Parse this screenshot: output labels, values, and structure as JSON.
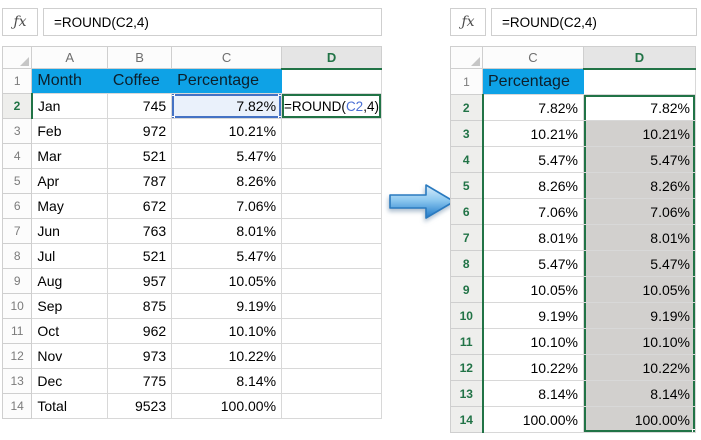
{
  "colors": {
    "header_fill_blue": "#0ea2e6",
    "excel_green": "#217346",
    "selection_gray": "#d2d0ce",
    "reference_blue": "#4a6fd4",
    "reference_fill": "#eaf1fb",
    "arrow_blue": "#1e78c8"
  },
  "left_sheet": {
    "formula_bar": {
      "fx_label": "ƒx",
      "formula": "=ROUND(C2,4)"
    },
    "column_headers": [
      "A",
      "B",
      "C",
      "D"
    ],
    "selected_column": "D",
    "row1_number": "1",
    "table_headers": {
      "a": "Month",
      "b": "Coffee",
      "c": "Percentage"
    },
    "active_row": {
      "n": "2",
      "a": "Jan",
      "b": "745",
      "c": "7.82%",
      "formula_pre": "=ROUND(",
      "formula_ref": "C2",
      "formula_post": ",4)"
    },
    "rows": [
      {
        "n": "3",
        "a": "Feb",
        "b": "972",
        "c": "10.21%"
      },
      {
        "n": "4",
        "a": "Mar",
        "b": "521",
        "c": "5.47%"
      },
      {
        "n": "5",
        "a": "Apr",
        "b": "787",
        "c": "8.26%"
      },
      {
        "n": "6",
        "a": "May",
        "b": "672",
        "c": "7.06%"
      },
      {
        "n": "7",
        "a": "Jun",
        "b": "763",
        "c": "8.01%"
      },
      {
        "n": "8",
        "a": "Jul",
        "b": "521",
        "c": "5.47%"
      },
      {
        "n": "9",
        "a": "Aug",
        "b": "957",
        "c": "10.05%"
      },
      {
        "n": "10",
        "a": "Sep",
        "b": "875",
        "c": "9.19%"
      },
      {
        "n": "11",
        "a": "Oct",
        "b": "962",
        "c": "10.10%"
      },
      {
        "n": "12",
        "a": "Nov",
        "b": "973",
        "c": "10.22%"
      },
      {
        "n": "13",
        "a": "Dec",
        "b": "775",
        "c": "8.14%"
      },
      {
        "n": "14",
        "a": "Total",
        "b": "9523",
        "c": "100.00%"
      }
    ]
  },
  "right_sheet": {
    "formula_bar": {
      "fx_label": "ƒx",
      "formula": "=ROUND(C2,4)"
    },
    "column_headers": [
      "C",
      "D"
    ],
    "selected_column": "D",
    "row1_number": "1",
    "table_header": "Percentage",
    "rows": [
      {
        "n": "2",
        "c": "7.82%",
        "d": "7.82%"
      },
      {
        "n": "3",
        "c": "10.21%",
        "d": "10.21%"
      },
      {
        "n": "4",
        "c": "5.47%",
        "d": "5.47%"
      },
      {
        "n": "5",
        "c": "8.26%",
        "d": "8.26%"
      },
      {
        "n": "6",
        "c": "7.06%",
        "d": "7.06%"
      },
      {
        "n": "7",
        "c": "8.01%",
        "d": "8.01%"
      },
      {
        "n": "8",
        "c": "5.47%",
        "d": "5.47%"
      },
      {
        "n": "9",
        "c": "10.05%",
        "d": "10.05%"
      },
      {
        "n": "10",
        "c": "9.19%",
        "d": "9.19%"
      },
      {
        "n": "11",
        "c": "10.10%",
        "d": "10.10%"
      },
      {
        "n": "12",
        "c": "10.22%",
        "d": "10.22%"
      },
      {
        "n": "13",
        "c": "8.14%",
        "d": "8.14%"
      },
      {
        "n": "14",
        "c": "100.00%",
        "d": "100.00%"
      }
    ]
  }
}
